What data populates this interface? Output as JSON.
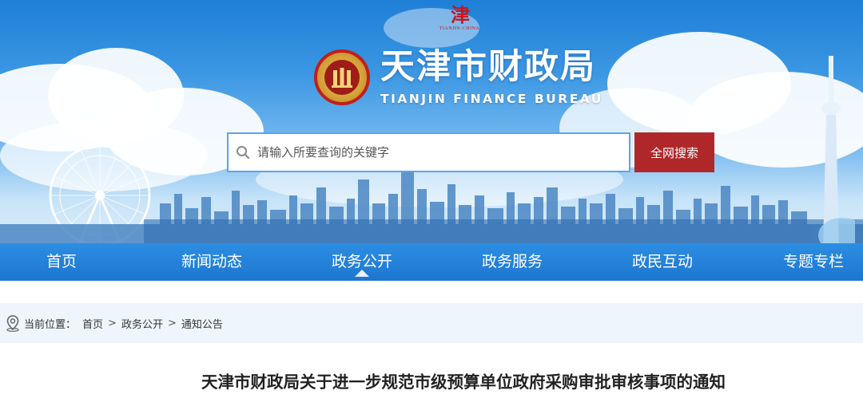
{
  "header": {
    "top_stamp": "津",
    "top_stamp_sub": "TIANJIN·CHINA",
    "site_title": "天津市财政局",
    "site_subtitle": "TIANJIN FINANCE BUREAU"
  },
  "search": {
    "placeholder": "请输入所要查询的关键字",
    "value": "",
    "button_label": "全网搜索"
  },
  "nav": {
    "items": [
      {
        "label": "首页"
      },
      {
        "label": "新闻动态"
      },
      {
        "label": "政务公开"
      },
      {
        "label": "政务服务"
      },
      {
        "label": "政民互动"
      },
      {
        "label": "专题专栏"
      }
    ],
    "active_index": 2
  },
  "breadcrumb": {
    "prefix": "当前位置：",
    "items": [
      "首页",
      "政务公开",
      "通知公告"
    ],
    "separator": ">"
  },
  "article": {
    "title": "天津市财政局关于进一步规范市级预算单位政府采购审批审核事项的通知"
  },
  "colors": {
    "nav_blue": "#1d76cf",
    "search_button": "#b0272a",
    "crumb_bg": "#eef5fc",
    "emblem_red": "#c0201c"
  },
  "icons": [
    "search-icon",
    "location-pin-icon",
    "emblem-icon"
  ]
}
